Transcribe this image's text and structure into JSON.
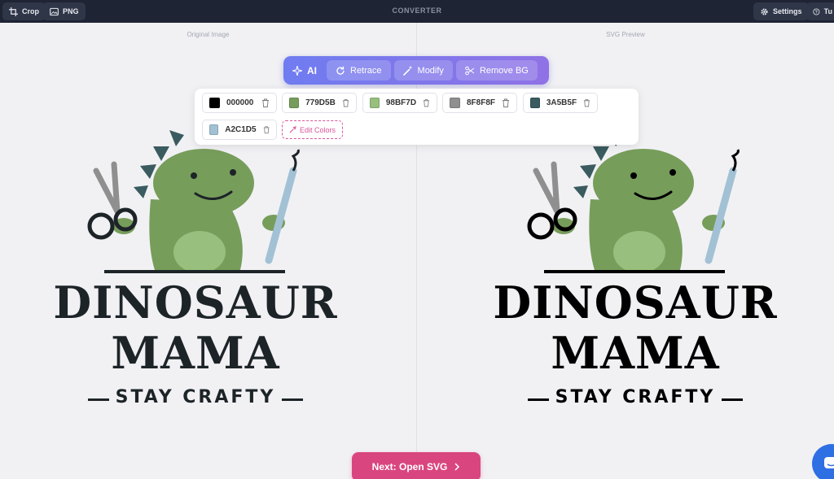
{
  "topbar": {
    "title": "CONVERTER",
    "crop_label": "Crop",
    "png_label": "PNG",
    "settings_label": "Settings",
    "tutorial_label": "Tu"
  },
  "panes": {
    "left_label": "Original Image",
    "right_label": "SVG Preview"
  },
  "toolbar": {
    "ai_label": "AI",
    "retrace_label": "Retrace",
    "modify_label": "Modify",
    "remove_bg_label": "Remove BG"
  },
  "palette": {
    "colors": [
      {
        "hex": "000000",
        "color": "#000000"
      },
      {
        "hex": "779D5B",
        "color": "#779D5B"
      },
      {
        "hex": "98BF7D",
        "color": "#98BF7D"
      },
      {
        "hex": "8F8F8F",
        "color": "#8F8F8F"
      },
      {
        "hex": "3A5B5F",
        "color": "#3A5B5F"
      },
      {
        "hex": "A2C1D5",
        "color": "#A2C1D5"
      }
    ],
    "edit_label": "Edit Colors"
  },
  "logo": {
    "line1": "DINOSAUR",
    "line2": "MAMA",
    "line3": "STAY CRAFTY"
  },
  "next_button": {
    "label": "Next: Open SVG"
  },
  "colors": {
    "topbar": "#1e2433",
    "accent_pink": "#d9467f",
    "toolbar_start": "#6f7cf0",
    "toolbar_end": "#8f72e6",
    "dino_body": "#779D5B",
    "dino_belly": "#98BF7D",
    "dino_spikes": "#3A5B5F",
    "scissor_gray": "#8F8F8F",
    "tool_blue": "#A2C1D5"
  }
}
